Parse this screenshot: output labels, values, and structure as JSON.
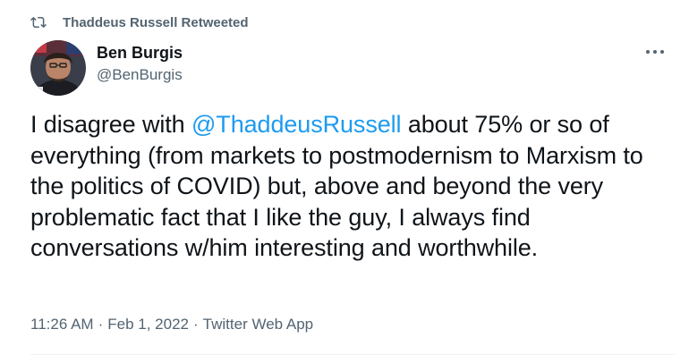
{
  "retweet": {
    "icon": "retweet-icon",
    "text": "Thaddeus Russell Retweeted"
  },
  "author": {
    "avatar": "avatar",
    "name": "Ben Burgis",
    "handle": "@BenBurgis"
  },
  "more_icon": "more-icon",
  "tweet": {
    "before_mention": "I disagree with ",
    "mention": "@ThaddeusRussell",
    "after_mention": " about 75% or so of everything (from markets to postmodernism to Marxism to the politics of COVID) but, above and beyond the very problematic fact that I like the guy, I always find conversations w/him interesting and worthwhile."
  },
  "meta": {
    "time": "11:26 AM",
    "separator": "·",
    "date": "Feb 1, 2022",
    "source": "Twitter Web App"
  },
  "colors": {
    "text": "#0f1419",
    "secondary": "#536471",
    "link": "#1d9bf0",
    "divider": "#eff3f4"
  }
}
